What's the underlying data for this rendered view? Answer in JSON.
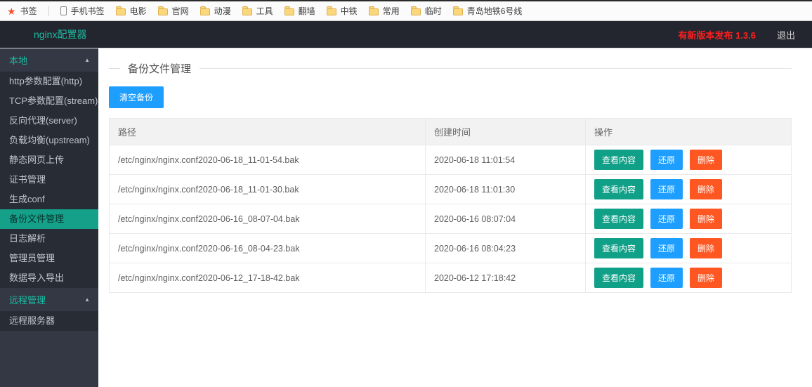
{
  "bookmarks_bar": {
    "star_label": "书签",
    "phone_label": "手机书签",
    "folders": [
      "电影",
      "官网",
      "动漫",
      "工具",
      "翻墙",
      "中铁",
      "常用",
      "临时",
      "青岛地铁6号线"
    ]
  },
  "header": {
    "title": "nginx配置器",
    "version_notice": "有新版本发布 1.3.6",
    "logout_label": "退出"
  },
  "sidebar": {
    "groups": [
      {
        "label": "本地",
        "expanded": true,
        "items": [
          {
            "label": "http参数配置(http)",
            "active": false
          },
          {
            "label": "TCP参数配置(stream)",
            "active": false
          },
          {
            "label": "反向代理(server)",
            "active": false
          },
          {
            "label": "负载均衡(upstream)",
            "active": false
          },
          {
            "label": "静态网页上传",
            "active": false
          },
          {
            "label": "证书管理",
            "active": false
          },
          {
            "label": "生成conf",
            "active": false
          },
          {
            "label": "备份文件管理",
            "active": true
          },
          {
            "label": "日志解析",
            "active": false
          },
          {
            "label": "管理员管理",
            "active": false
          },
          {
            "label": "数据导入导出",
            "active": false
          }
        ]
      },
      {
        "label": "远程管理",
        "expanded": true,
        "items": [
          {
            "label": "远程服务器",
            "active": false
          }
        ]
      }
    ]
  },
  "main": {
    "section_title": "备份文件管理",
    "clear_button_label": "清空备份",
    "table": {
      "headers": [
        "路径",
        "创建时间",
        "操作"
      ],
      "action_labels": [
        "查看内容",
        "还原",
        "删除"
      ],
      "rows": [
        {
          "path": "/etc/nginx/nginx.conf2020-06-18_11-01-54.bak",
          "created": "2020-06-18 11:01:54"
        },
        {
          "path": "/etc/nginx/nginx.conf2020-06-18_11-01-30.bak",
          "created": "2020-06-18 11:01:30"
        },
        {
          "path": "/etc/nginx/nginx.conf2020-06-16_08-07-04.bak",
          "created": "2020-06-16 08:07:04"
        },
        {
          "path": "/etc/nginx/nginx.conf2020-06-16_08-04-23.bak",
          "created": "2020-06-16 08:04:23"
        },
        {
          "path": "/etc/nginx/nginx.conf2020-06-12_17-18-42.bak",
          "created": "2020-06-12 17:18:42"
        }
      ]
    }
  },
  "colors": {
    "teal": "#1CBCA2",
    "teal_dark": "#14A089",
    "blue": "#1E9FFF",
    "danger": "#FF5722",
    "version_red": "#FF1F1F",
    "header_bg": "#23262E",
    "side_bg": "#343845",
    "side_item_bg": "#282C35"
  }
}
